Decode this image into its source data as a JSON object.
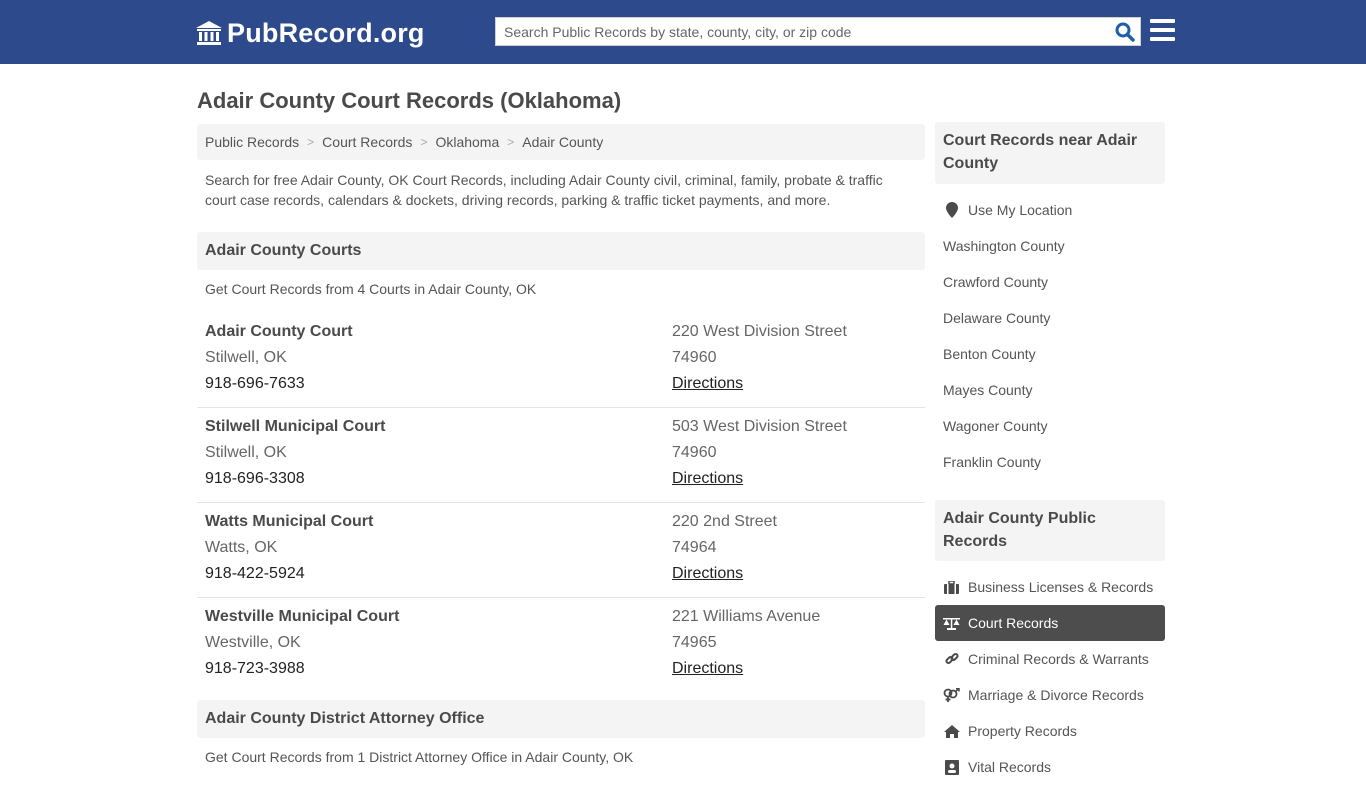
{
  "header": {
    "logo_text": "PubRecord.org",
    "search_placeholder": "Search Public Records by state, county, city, or zip code",
    "brand_color": "#2d4a8d"
  },
  "page": {
    "title": "Adair County Court Records (Oklahoma)",
    "breadcrumb": [
      "Public Records",
      "Court Records",
      "Oklahoma",
      "Adair County"
    ],
    "intro": "Search for free Adair County, OK Court Records, including Adair County civil, criminal, family, probate & traffic court case records, calendars & dockets, driving records, parking & traffic ticket payments, and more."
  },
  "courts_section": {
    "heading": "Adair County Courts",
    "subtitle": "Get Court Records from 4 Courts in Adair County, OK",
    "items": [
      {
        "name": "Adair County Court",
        "city": "Stilwell, OK",
        "phone": "918-696-7633",
        "address": "220 West Division Street",
        "zip": "74960",
        "directions": "Directions"
      },
      {
        "name": "Stilwell Municipal Court",
        "city": "Stilwell, OK",
        "phone": "918-696-3308",
        "address": "503 West Division Street",
        "zip": "74960",
        "directions": "Directions"
      },
      {
        "name": "Watts Municipal Court",
        "city": "Watts, OK",
        "phone": "918-422-5924",
        "address": "220 2nd Street",
        "zip": "74964",
        "directions": "Directions"
      },
      {
        "name": "Westville Municipal Court",
        "city": "Westville, OK",
        "phone": "918-723-3988",
        "address": "221 Williams Avenue",
        "zip": "74965",
        "directions": "Directions"
      }
    ]
  },
  "da_section": {
    "heading": "Adair County District Attorney Office",
    "subtitle": "Get Court Records from 1 District Attorney Office in Adair County, OK"
  },
  "sidebar": {
    "nearby_heading": "Court Records near Adair County",
    "use_location": "Use My Location",
    "nearby": [
      "Washington County",
      "Crawford County",
      "Delaware County",
      "Benton County",
      "Mayes County",
      "Wagoner County",
      "Franklin County"
    ],
    "public_heading": "Adair County Public Records",
    "public_items": [
      {
        "label": "Business Licenses & Records",
        "icon": "briefcase-icon",
        "active": false
      },
      {
        "label": "Court Records",
        "icon": "balance-scale-icon",
        "active": true
      },
      {
        "label": "Criminal Records & Warrants",
        "icon": "link-icon",
        "active": false
      },
      {
        "label": "Marriage & Divorce Records",
        "icon": "venus-mars-icon",
        "active": false
      },
      {
        "label": "Property Records",
        "icon": "home-icon",
        "active": false
      },
      {
        "label": "Vital Records",
        "icon": "id-card-icon",
        "active": false
      }
    ]
  }
}
